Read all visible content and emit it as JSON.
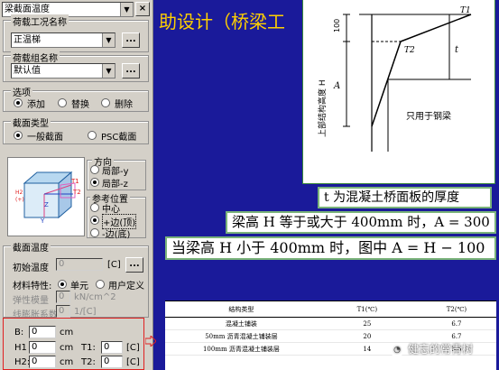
{
  "panel": {
    "top_combo": "梁截面温度",
    "load_case": {
      "label": "荷载工况名称",
      "value": "正温梯"
    },
    "load_group": {
      "label": "荷载组名称",
      "value": "默认值"
    },
    "options": {
      "label": "选项",
      "items": [
        "添加",
        "替换",
        "删除"
      ],
      "selected": 0
    },
    "section_type": {
      "label": "截面类型",
      "items": [
        "一般截面",
        "PSC截面"
      ],
      "selected": 0
    },
    "preview": {
      "labels": [
        "T1",
        "T2",
        "Z",
        "Y"
      ]
    },
    "direction": {
      "label": "方向",
      "items": [
        "局部-y",
        "局部-z"
      ],
      "selected": 1
    },
    "ref_pos": {
      "label": "参考位置",
      "items": [
        "中心",
        "+边(顶)",
        "-边(底)"
      ],
      "selected": 1
    },
    "section_temp": {
      "label": "截面温度",
      "init_temp_label": "初始温度",
      "init_temp_value": "0",
      "init_temp_unit": "[C]",
      "material_label": "材料特性:",
      "material_items": [
        "单元",
        "用户定义"
      ],
      "material_selected": 0,
      "elastic_label": "弹性模量",
      "elastic_value": "0",
      "elastic_unit": "kN/cm^2",
      "thermal_label": "线膨胀系数",
      "thermal_value": "0",
      "thermal_unit": "1/[C]"
    },
    "dims": {
      "b_label": "B:",
      "b_value": "0",
      "b_unit": "cm",
      "h1_label": "H1",
      "h1_value": "0",
      "h1_unit": "cm",
      "h2_label": "H2:",
      "h2_value": "0",
      "h2_unit": "cm",
      "t1_label": "T1:",
      "t1_value": "0",
      "t1_unit": "[C]",
      "t2_label": "T2:",
      "t2_value": "0",
      "t2_unit": "[C]"
    }
  },
  "slide": {
    "title": "助设计（桥梁工",
    "diagram": {
      "t1": "T1",
      "t2": "T2",
      "dim100": "100",
      "dimA": "A",
      "dimt": "t",
      "vlabel": "上部结构高度 H",
      "note": "只用于钢梁"
    },
    "line1": "t 为混凝土桥面板的厚度",
    "line2": "梁高 H 等于或大于 400mm 时，A = 300",
    "line3": "当梁高  H 小于 400mm 时，图中 A = H − 100",
    "table": {
      "headers": [
        "结构类型",
        "T1(℃)",
        "T2(℃)"
      ],
      "rows": [
        [
          "混凝土铺装",
          "25",
          "6.7"
        ],
        [
          "50mm 沥青混凝土铺装层",
          "20",
          "6.7"
        ],
        [
          "100mm 沥青混凝土铺装层",
          "14",
          "5.5"
        ]
      ]
    },
    "watermark": "健忘的常青树"
  }
}
